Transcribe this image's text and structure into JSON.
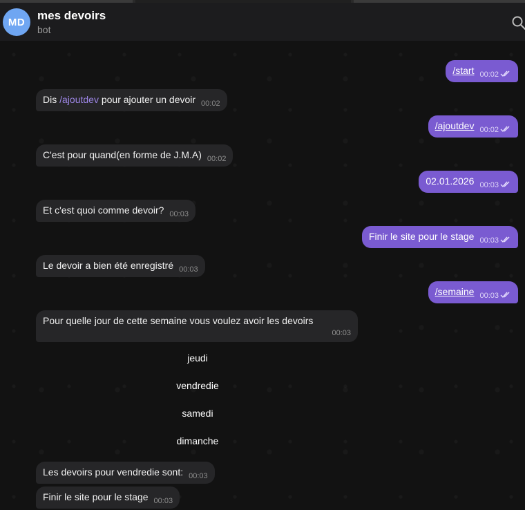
{
  "header": {
    "avatar_initials": "MD",
    "title": "mes devoirs",
    "subtitle": "bot",
    "search_icon": "search-icon"
  },
  "colors": {
    "outgoing_bubble": "#7a5bd1",
    "incoming_bubble": "#262628",
    "avatar": "#6fa6f2",
    "command_link": "#9d86e6"
  },
  "messages": [
    {
      "dir": "out",
      "text": "/start",
      "time": "00:02"
    },
    {
      "dir": "in",
      "prefix": "Dis ",
      "command": "/ajoutdev",
      "suffix": " pour ajouter un devoir",
      "time": "00:02"
    },
    {
      "dir": "out",
      "text": "/ajoutdev",
      "time": "00:02"
    },
    {
      "dir": "in",
      "text": "C'est pour quand(en forme de J.M.A)",
      "time": "00:02"
    },
    {
      "dir": "out",
      "text": "02.01.2026",
      "time": "00:03"
    },
    {
      "dir": "in",
      "text": "Et c'est quoi comme devoir?",
      "time": "00:03"
    },
    {
      "dir": "out",
      "text": "Finir le site pour le stage",
      "time": "00:03"
    },
    {
      "dir": "in",
      "text": "Le devoir a bien été enregistré",
      "time": "00:03"
    },
    {
      "dir": "out",
      "text": "/semaine",
      "time": "00:03"
    },
    {
      "dir": "in",
      "text": "Pour quelle jour de cette semaine vous voulez avoir les devoirs",
      "time": "00:03"
    },
    {
      "dir": "in",
      "text": "Les devoirs pour vendredie sont:",
      "time": "00:03"
    },
    {
      "dir": "in",
      "text": "Finir le site pour le stage",
      "time": "00:03"
    }
  ],
  "keyboard": [
    "jeudi",
    "vendredie",
    "samedi",
    "dimanche"
  ]
}
